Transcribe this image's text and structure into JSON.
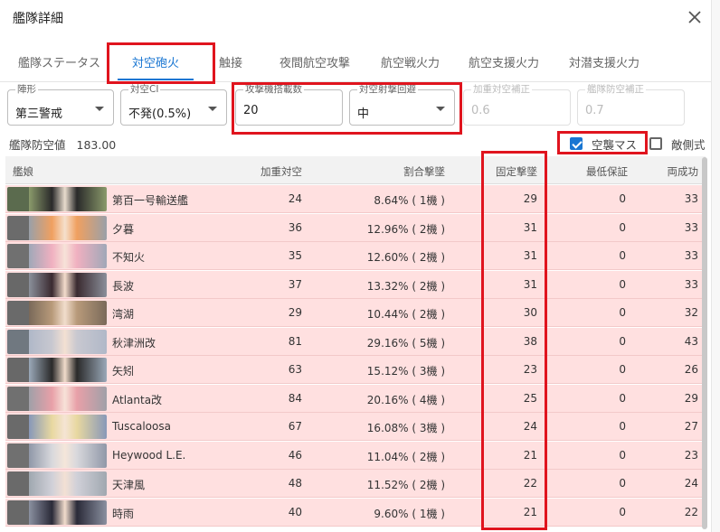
{
  "dialog": {
    "title": "艦隊詳細"
  },
  "tabs": [
    {
      "label": "艦隊ステータス",
      "active": false
    },
    {
      "label": "対空砲火",
      "active": true
    },
    {
      "label": "触接",
      "active": false
    },
    {
      "label": "夜間航空攻撃",
      "active": false
    },
    {
      "label": "航空戦火力",
      "active": false
    },
    {
      "label": "航空支援火力",
      "active": false
    },
    {
      "label": "対潜支援火力",
      "active": false
    }
  ],
  "fields": {
    "formation": {
      "label": "陣形",
      "value": "第三警戒"
    },
    "aaci": {
      "label": "対空CI",
      "value": "不発(0.5%)"
    },
    "attackers": {
      "label": "攻撃機搭載数",
      "value": "20"
    },
    "aa_evasion": {
      "label": "対空射撃回避",
      "value": "中"
    },
    "weighted_bonus": {
      "label": "加重対空補正",
      "value": "0.6"
    },
    "fleet_bonus": {
      "label": "艦隊防空補正",
      "value": "0.7"
    }
  },
  "fleet_aa": {
    "label": "艦隊防空値",
    "value": "183.00"
  },
  "checkboxes": {
    "air_raid": {
      "label": "空襲マス",
      "checked": true
    },
    "enemy_side": {
      "label": "敵側式",
      "checked": false
    }
  },
  "table": {
    "headers": {
      "ship": "艦娘",
      "weighted_aa": "加重対空",
      "proportional": "割合撃墜",
      "fixed": "固定撃墜",
      "min_guarantee": "最低保証",
      "both_success": "両成功"
    },
    "rows": [
      {
        "name": "第百一号輸送艦",
        "weighted_aa": "24",
        "proportional": "8.64% ( 1機 )",
        "fixed": "29",
        "min_guarantee": "0",
        "both_success": "33",
        "colors": [
          "#5b6b4e",
          "#2a2a2a",
          "#e8dccd",
          "#8a9a6b"
        ]
      },
      {
        "name": "夕暮",
        "weighted_aa": "36",
        "proportional": "12.96% ( 2機 )",
        "fixed": "31",
        "min_guarantee": "0",
        "both_success": "33",
        "colors": [
          "#6b6b6b",
          "#f0a060",
          "#f5e0cc",
          "#9aa0a8"
        ]
      },
      {
        "name": "不知火",
        "weighted_aa": "35",
        "proportional": "12.60% ( 2機 )",
        "fixed": "31",
        "min_guarantee": "0",
        "both_success": "33",
        "colors": [
          "#707070",
          "#f0b0c0",
          "#f7e2d8",
          "#a0a8b8"
        ]
      },
      {
        "name": "長波",
        "weighted_aa": "37",
        "proportional": "13.32% ( 2機 )",
        "fixed": "31",
        "min_guarantee": "0",
        "both_success": "33",
        "colors": [
          "#686868",
          "#3a2a30",
          "#f3dccb",
          "#8a8f9a"
        ]
      },
      {
        "name": "湾湖",
        "weighted_aa": "29",
        "proportional": "10.44% ( 2機 )",
        "fixed": "30",
        "min_guarantee": "0",
        "both_success": "32",
        "colors": [
          "#6a6a6a",
          "#b89a7a",
          "#f1ddcc",
          "#7a6a5a"
        ]
      },
      {
        "name": "秋津洲改",
        "weighted_aa": "81",
        "proportional": "29.16% ( 5機 )",
        "fixed": "38",
        "min_guarantee": "0",
        "both_success": "43",
        "colors": [
          "#707880",
          "#c8c8d0",
          "#f3e0d2",
          "#b0b8c8"
        ]
      },
      {
        "name": "矢矧",
        "weighted_aa": "63",
        "proportional": "15.12% ( 3機 )",
        "fixed": "23",
        "min_guarantee": "0",
        "both_success": "26",
        "colors": [
          "#686868",
          "#2a2a2a",
          "#f0dcca",
          "#9aa8b8"
        ]
      },
      {
        "name": "Atlanta改",
        "weighted_aa": "84",
        "proportional": "20.16% ( 4機 )",
        "fixed": "25",
        "min_guarantee": "0",
        "both_success": "29",
        "colors": [
          "#707070",
          "#e8a0a8",
          "#f7e2d8",
          "#a0a0a8"
        ]
      },
      {
        "name": "Tuscaloosa",
        "weighted_aa": "67",
        "proportional": "16.08% ( 3機 )",
        "fixed": "24",
        "min_guarantee": "0",
        "both_success": "27",
        "colors": [
          "#6a6a6a",
          "#e8d8a0",
          "#f5e4d4",
          "#8898b8"
        ]
      },
      {
        "name": "Heywood L.E.",
        "weighted_aa": "46",
        "proportional": "11.04% ( 2機 )",
        "fixed": "21",
        "min_guarantee": "0",
        "both_success": "23",
        "colors": [
          "#707070",
          "#d8d8dc",
          "#f5e6da",
          "#9098a8"
        ]
      },
      {
        "name": "天津風",
        "weighted_aa": "48",
        "proportional": "11.52% ( 2機 )",
        "fixed": "22",
        "min_guarantee": "0",
        "both_success": "24",
        "colors": [
          "#6a6a6a",
          "#d0d0d8",
          "#f3e0d4",
          "#a0a8b0"
        ]
      },
      {
        "name": "時雨",
        "weighted_aa": "40",
        "proportional": "9.60% ( 1機 )",
        "fixed": "21",
        "min_guarantee": "0",
        "both_success": "22",
        "colors": [
          "#686868",
          "#2a2a38",
          "#f1dccc",
          "#8a90a0"
        ]
      }
    ]
  }
}
